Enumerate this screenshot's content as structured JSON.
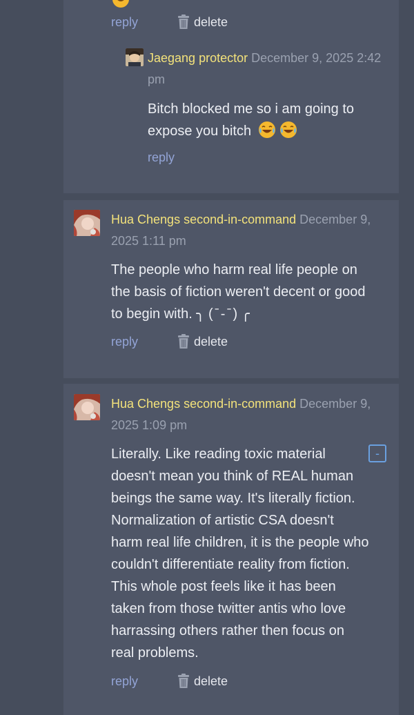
{
  "comments": [
    {
      "reply_label": "reply",
      "delete_label": "delete"
    },
    {
      "author": "Jaegang protector",
      "date_line1": "December 9, 2025 2:42",
      "date_line2": "pm",
      "body_line1": "Bitch blocked me so i am going to",
      "body_line2": "expose you bitch",
      "emoji": "face-with-tears-of-joy x2",
      "reply_label": "reply"
    },
    {
      "author": "Hua Chengs second-in-command",
      "date_line1": "December 9,",
      "date_line2": "2025 1:11 pm",
      "body_lines": [
        "The people who harm real life people on",
        "the basis of fiction weren't decent or good",
        "to begin with. ╮ ( ̄ - ̄ ) ╭"
      ],
      "reply_label": "reply",
      "delete_label": "delete"
    },
    {
      "author": "Hua Chengs second-in-command",
      "date_line1": "December 9,",
      "date_line2": "2025 1:09 pm",
      "collapse_label": "-",
      "body_lines": [
        "Literally. Like reading toxic material",
        "doesn't mean you think of REAL human",
        "beings the same way. It's literally fiction.",
        "Normalization of artistic CSA doesn't",
        "harm real life children, it is the people who",
        "couldn't differentiate reality from fiction.",
        "This whole post feels like it has been",
        "taken from those twitter antis who love",
        "harrassing others rather then focus on",
        "real problems."
      ],
      "reply_label": "reply",
      "delete_label": "delete"
    }
  ],
  "colors": {
    "page_bg": "#464d5c",
    "card_bg": "#4f5667",
    "author": "#f3e27b",
    "timestamp": "#9aa1b0",
    "reply_link": "#93a4d6",
    "collapse_button": "#6aa0e0"
  }
}
